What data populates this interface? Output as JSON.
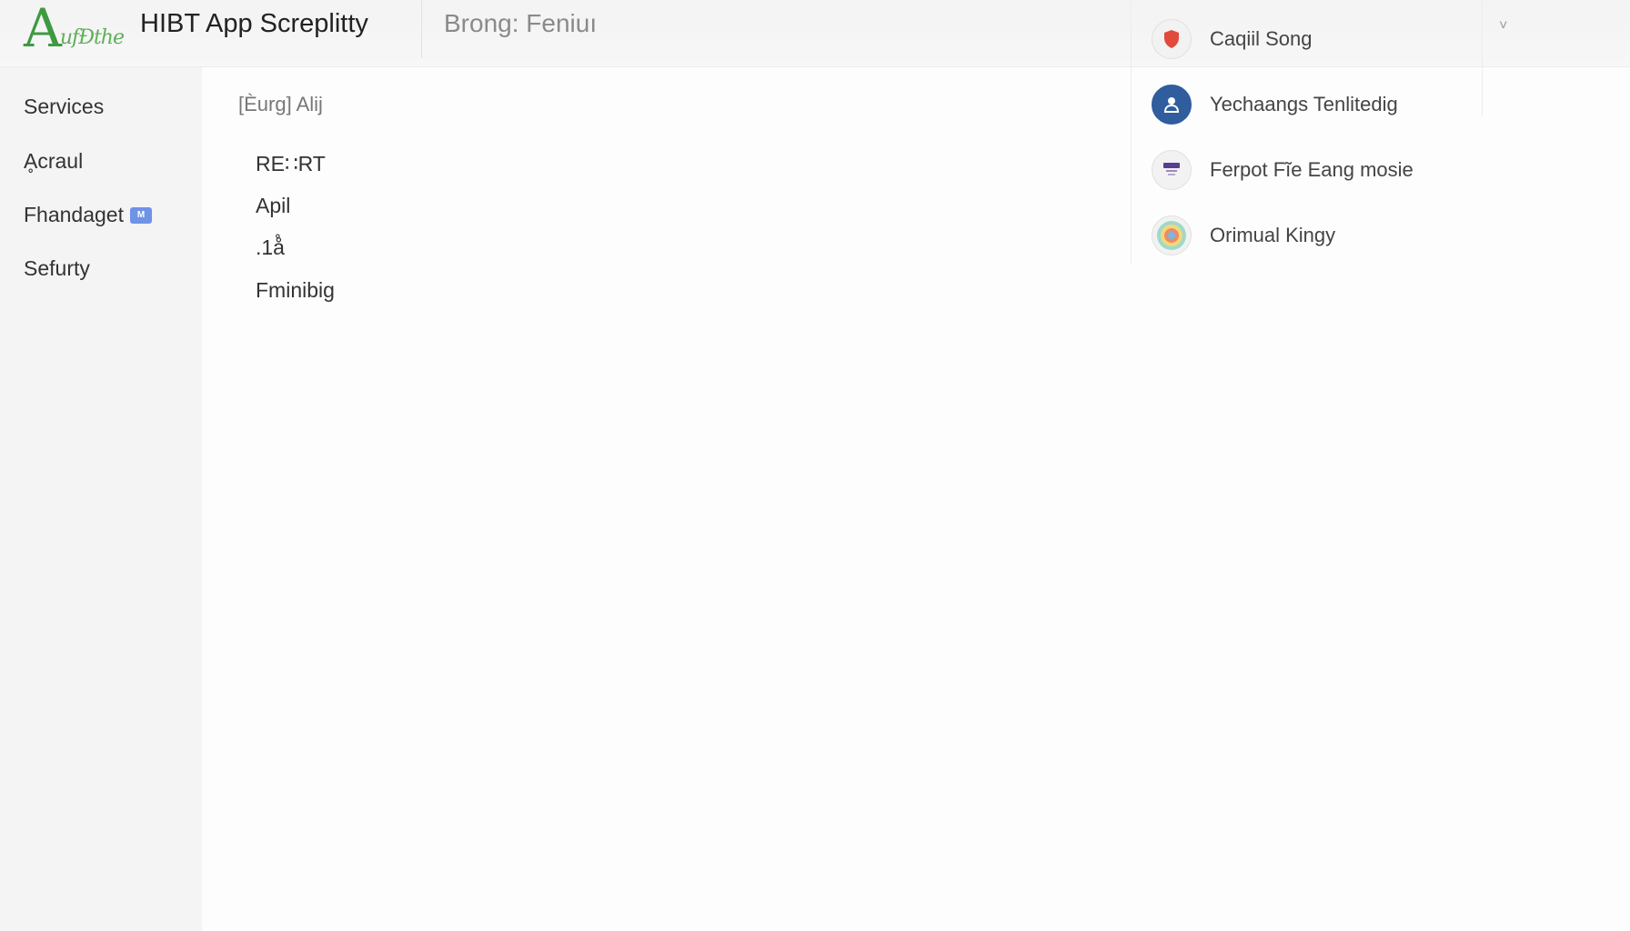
{
  "header": {
    "logo_text": "A",
    "logo_script": "ufÐthe",
    "app_title": "HIBT App Screplitty",
    "context": "Brong: Feniuı",
    "chevron": "˅"
  },
  "sidebar": {
    "items": [
      {
        "label": "Services"
      },
      {
        "label": "Ḁcraul"
      },
      {
        "label": "Fhandaget",
        "badge": "M"
      },
      {
        "label": "Sefurty"
      }
    ]
  },
  "main": {
    "breadcrumb": "[Èurg] Alij",
    "items": [
      {
        "label": "RE∷RT"
      },
      {
        "label": "Apil"
      },
      {
        "label": ".1å̊"
      },
      {
        "label": "Fminibig"
      }
    ]
  },
  "panel": {
    "items": [
      {
        "label": "Caqiil Song",
        "icon": "red-shield-icon",
        "color": "#e24a3b"
      },
      {
        "label": "Yechaangs Tenlitedig",
        "icon": "person-badge-icon",
        "color": "#2f5d9e"
      },
      {
        "label": "Ferpot Fĩe Eang mosie",
        "icon": "certificate-seal-icon",
        "color": "#5a3e8f"
      },
      {
        "label": "Orimual Kingy",
        "icon": "colorful-emblem-icon",
        "color": "#d7a43a"
      }
    ]
  }
}
